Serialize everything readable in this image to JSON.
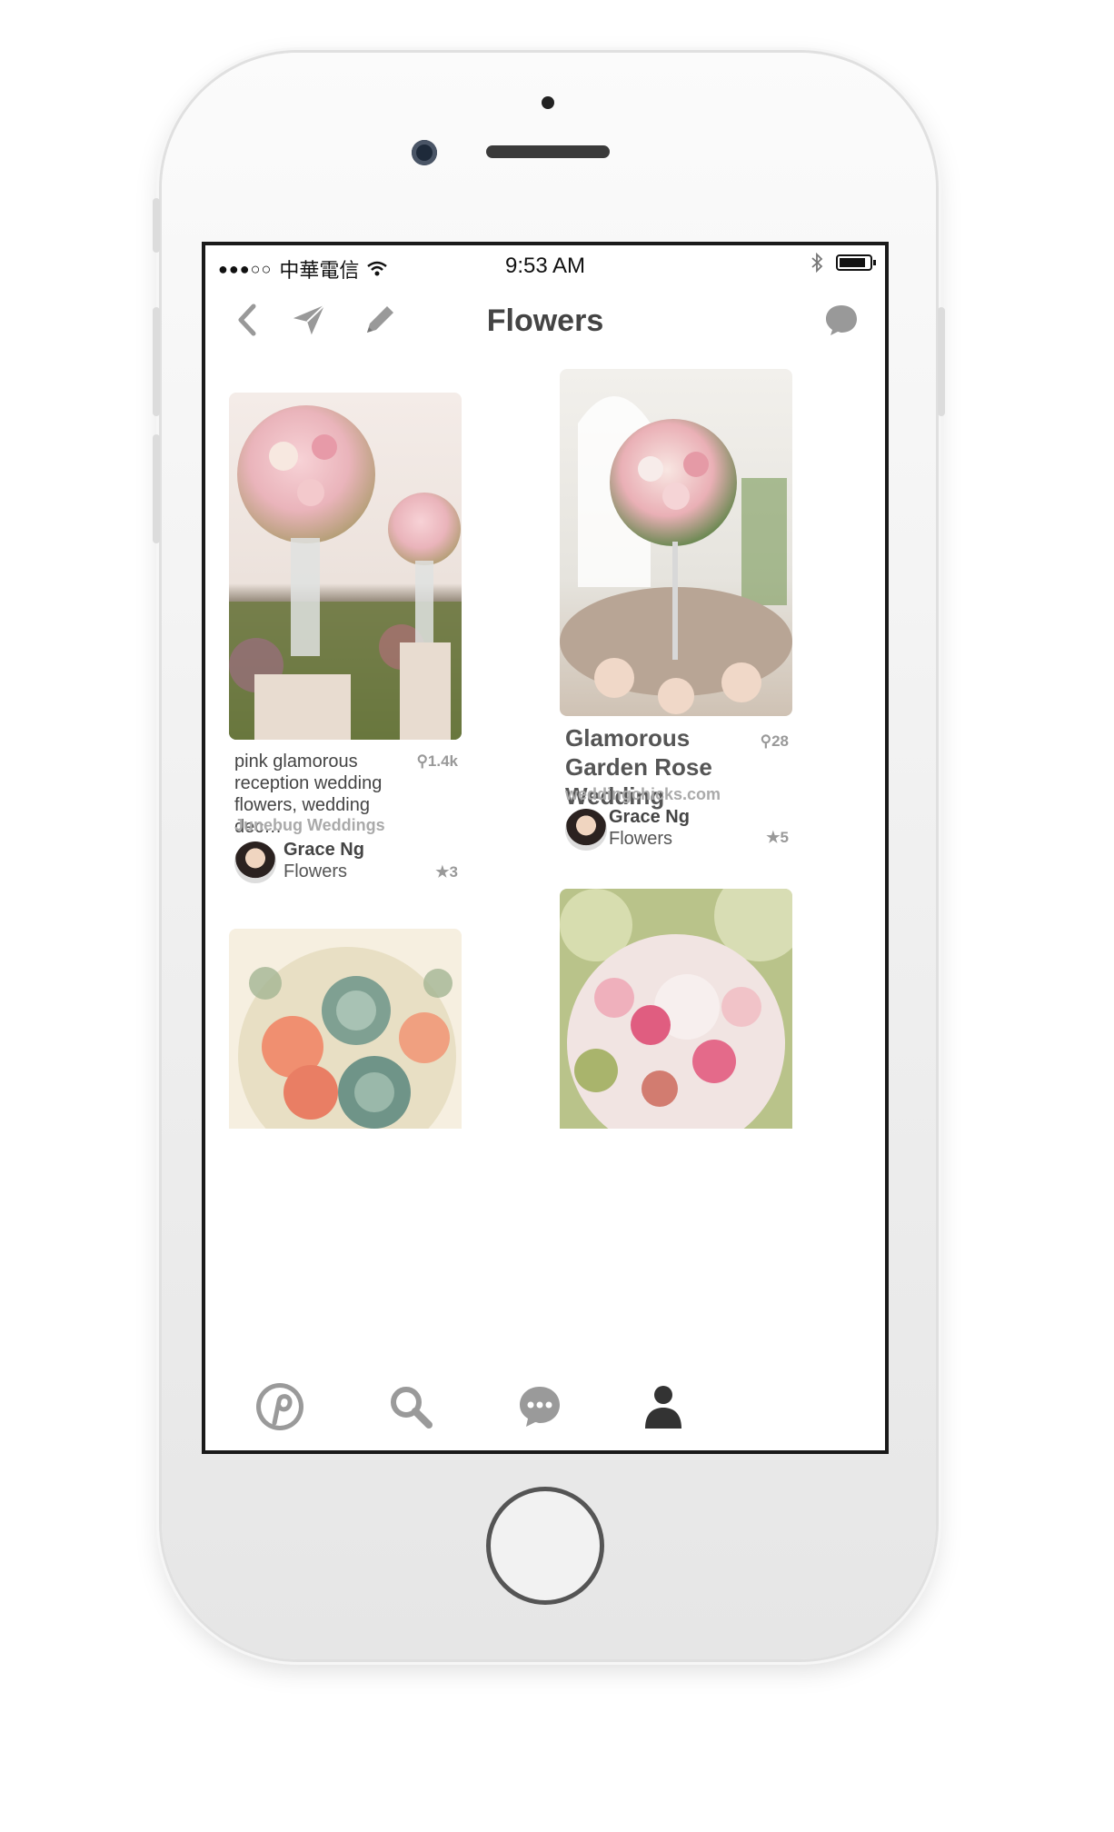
{
  "status_bar": {
    "signal_dots": "●●●○○",
    "carrier": "中華電信",
    "time": "9:53 AM"
  },
  "nav": {
    "title": "Flowers",
    "icons": [
      "back-icon",
      "send-icon",
      "edit-icon",
      "message-icon"
    ]
  },
  "pins": [
    {
      "description": "pink glamorous reception wedding flowers, wedding dec…",
      "repin_count": "1.4k",
      "source": "Junebug Weddings",
      "pinner": "Grace Ng",
      "board": "Flowers",
      "like_count": "3"
    },
    {
      "title": "Glamorous Garden Rose Wedding",
      "repin_count": "28",
      "source": "weddingchicks.com",
      "pinner": "Grace Ng",
      "board": "Flowers",
      "like_count": "5"
    },
    {},
    {}
  ],
  "tabs": [
    "home-icon",
    "search-icon",
    "messages-icon",
    "profile-icon"
  ],
  "colors": {
    "icon_gray": "#999999",
    "text_dark": "#444444",
    "text_light": "#aaaaaa"
  }
}
